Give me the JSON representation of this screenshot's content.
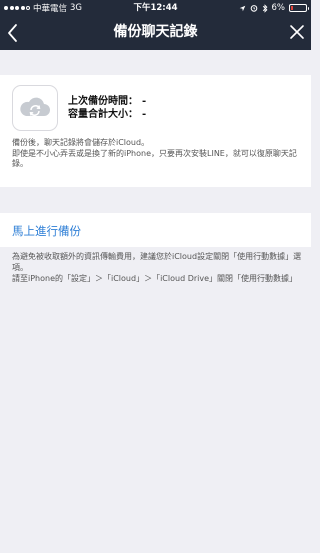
{
  "status_bar": {
    "carrier": "中華電信",
    "network": "3G",
    "time": "下午12:44",
    "battery_percent": "6%",
    "battery_level": 0.06,
    "signal_bars": 4
  },
  "nav": {
    "title": "備份聊天記錄",
    "back_icon": "chevron-left-icon",
    "close_icon": "close-icon"
  },
  "backup_info": {
    "icon": "cloud-sync-icon",
    "last_backup_label": "上次備份時間：",
    "last_backup_value": "-",
    "total_size_label": "容量合計大小：",
    "total_size_value": "-",
    "note": "備份後，聊天記錄將會儲存於iCloud。\n即使是不小心弄丟或是換了新的iPhone，只要再次安裝LINE，就可以復原聊天記錄。"
  },
  "actions": {
    "backup_now_label": "馬上進行備份"
  },
  "footnote": "為避免被收取額外的資訊傳輸費用，建議您於iCloud設定關閉「使用行動數據」選項。\n請至iPhone的「設定」＞「iCloud」＞「iCloud Drive」關閉「使用行動數據」",
  "colors": {
    "header_bg": "#232b3a",
    "page_bg": "#efeff4",
    "link": "#2f7fd6",
    "battery_low": "#e0433a"
  }
}
